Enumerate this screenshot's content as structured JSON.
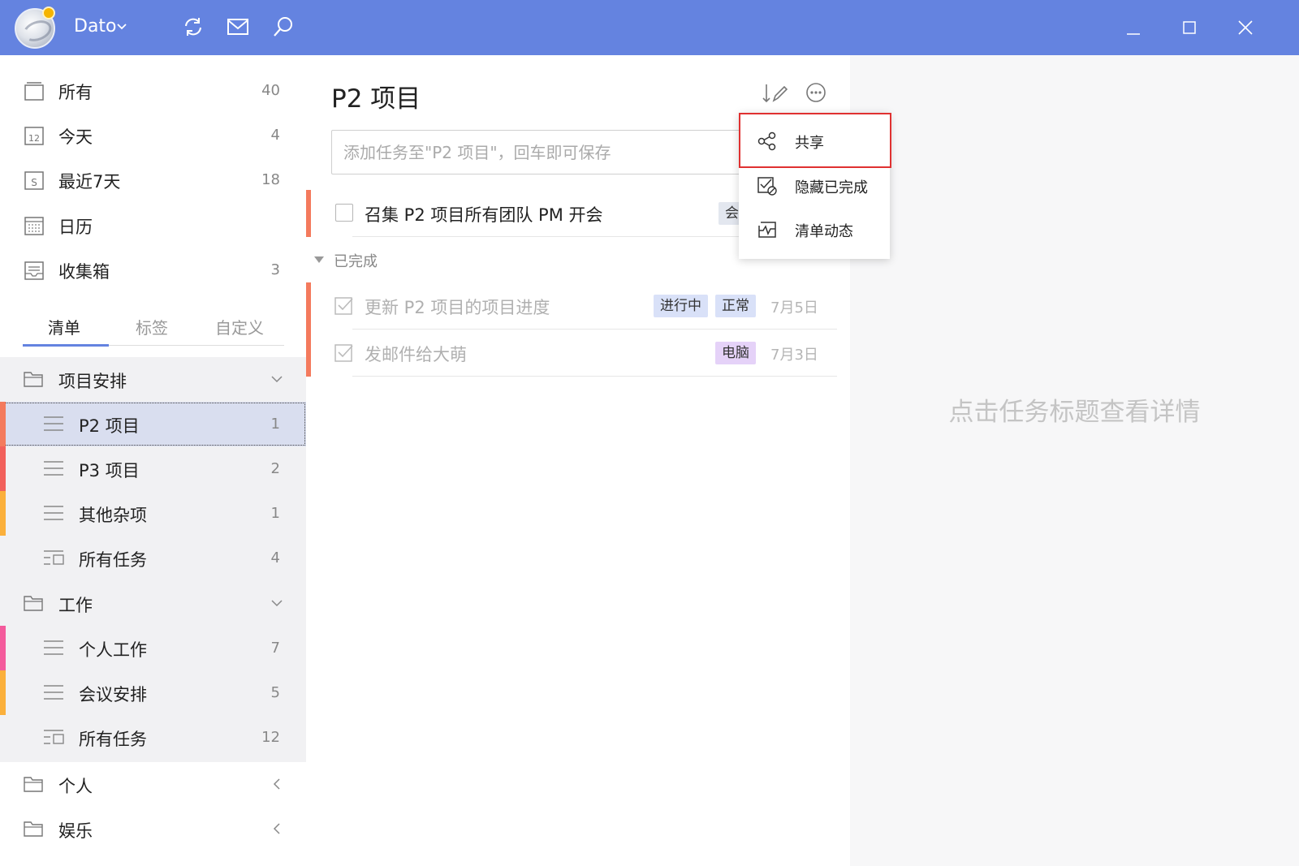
{
  "titlebar": {
    "user_name": "Dato",
    "bg_color": "#6483e0",
    "icons": [
      "sync-icon",
      "mail-icon",
      "search-icon"
    ],
    "window_controls": [
      "minimize-icon",
      "maximize-icon",
      "close-icon"
    ]
  },
  "smart_lists": [
    {
      "label": "所有",
      "count": "40",
      "icon": "inbox-all-icon"
    },
    {
      "label": "今天",
      "count": "4",
      "icon": "calendar-12-icon",
      "icon_text": "12"
    },
    {
      "label": "最近7天",
      "count": "18",
      "icon": "calendar-s-icon",
      "icon_text": "S"
    },
    {
      "label": "日历",
      "count": "",
      "icon": "calendar-grid-icon"
    },
    {
      "label": "收集箱",
      "count": "3",
      "icon": "tray-icon"
    }
  ],
  "tabs": [
    "清单",
    "标签",
    "自定义"
  ],
  "tree": {
    "group1": {
      "label": "项目安排"
    },
    "group1_items": [
      {
        "label": "P2 项目",
        "count": "1",
        "color": "#f47a5d"
      },
      {
        "label": "P3 项目",
        "count": "2",
        "color": "#f2605b"
      },
      {
        "label": "其他杂项",
        "count": "1",
        "color": "#fbb03b"
      },
      {
        "label": "所有任务",
        "count": "4",
        "color": ""
      }
    ],
    "group2": {
      "label": "工作"
    },
    "group2_items": [
      {
        "label": "个人工作",
        "count": "7",
        "color": "#f45b9c"
      },
      {
        "label": "会议安排",
        "count": "5",
        "color": "#fbb03b"
      },
      {
        "label": "所有任务",
        "count": "12",
        "color": ""
      }
    ],
    "group3": {
      "label": "个人"
    },
    "group4": {
      "label": "娱乐"
    }
  },
  "middle": {
    "title": "P2 项目",
    "add_placeholder": "添加任务至\"P2 项目\"，回车即可保存",
    "tasks": [
      {
        "title": "召集 P2 项目所有团队 PM 开会",
        "tag": "会"
      }
    ],
    "completed_label": "已完成",
    "completed_tasks": [
      {
        "title": "更新 P2 项目的项目进度",
        "tags": [
          "进行中",
          "正常"
        ],
        "date": "7月5日"
      },
      {
        "title": "发邮件给大萌",
        "tags": [
          "电脑"
        ],
        "date": "7月3日"
      }
    ]
  },
  "menu": {
    "items": [
      {
        "label": "共享",
        "icon": "share-icon"
      },
      {
        "label": "隐藏已完成",
        "icon": "hide-completed-icon"
      },
      {
        "label": "清单动态",
        "icon": "activity-icon"
      }
    ],
    "highlight_color": "#e03131"
  },
  "detail": {
    "hint": "点击任务标题查看详情"
  }
}
